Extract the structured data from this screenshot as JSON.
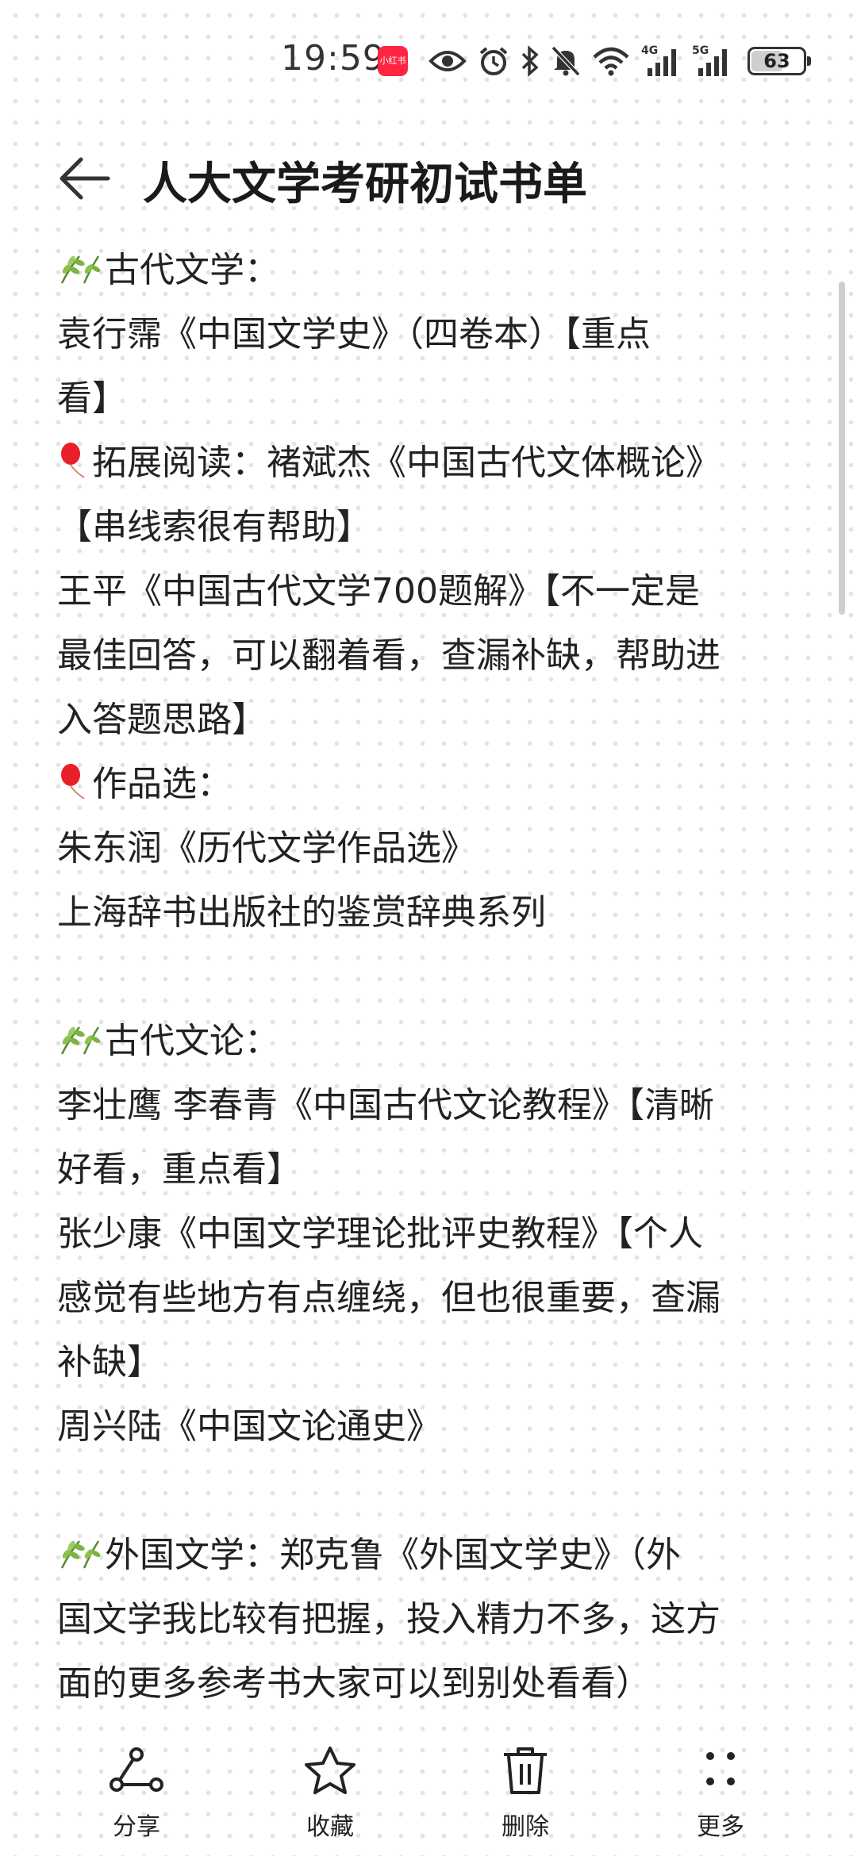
{
  "status_bar": {
    "time": "19:59",
    "app_badge": "小红书",
    "network_4g": "4G",
    "network_5g": "5G",
    "battery": "63",
    "battery_level": 0.63,
    "icons": [
      "eye-icon",
      "alarm-icon",
      "bluetooth-icon",
      "mute-icon",
      "wifi-icon",
      "signal-icon",
      "signal-icon",
      "battery-icon"
    ]
  },
  "header": {
    "title": "人大文学考研初试书单"
  },
  "content": {
    "lines": [
      "古代文学：",
      "袁行霈《中国文学史》（四卷本）【重点",
      "看】",
      "拓展阅读：褚斌杰《中国古代文体概论》",
      "【串线索很有帮助】",
      "王平《中国古代文学700题解》【不一定是",
      "最佳回答，可以翻着看，查漏补缺，帮助进",
      "入答题思路】",
      "作品选：",
      "朱东润《历代文学作品选》",
      "上海辞书出版社的鉴赏辞典系列",
      "古代文论：",
      "李壮鹰 李春青《中国古代文论教程》【清晰",
      "好看，重点看】",
      "张少康《中国文学理论批评史教程》【个人",
      "感觉有些地方有点缠绕，但也很重要，查漏",
      "补缺】",
      "周兴陆《中国文论通史》",
      "外国文学：郑克鲁《外国文学史》（外",
      "国文学我比较有把握，投入精力不多，这方",
      "面的更多参考书大家可以到别处看看）"
    ]
  },
  "bottom_bar": {
    "share": "分享",
    "collect": "收藏",
    "delete": "删除",
    "more": "更多"
  },
  "colors": {
    "badge": "#ff2442",
    "text": "#222222",
    "balloon": "#e8202a",
    "leaf": "#7cb342"
  }
}
